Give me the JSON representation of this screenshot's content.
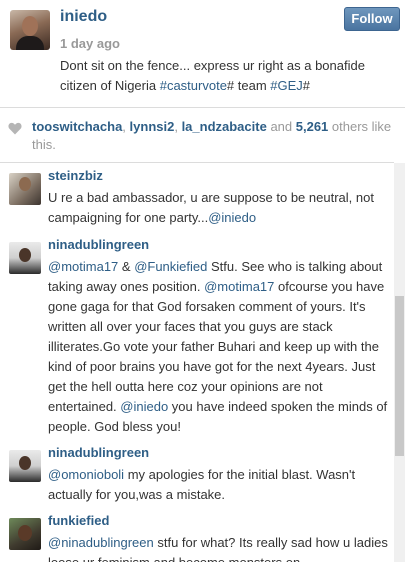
{
  "post": {
    "username": "iniedo",
    "timestamp": "1 day ago",
    "follow_label": "Follow",
    "caption_text": "Dont sit on the fence... express ur right as a bonafide citizen of Nigeria ",
    "caption_tag1": "#casturvote",
    "caption_mid": "# team ",
    "caption_tag2": "#GEJ",
    "caption_end": "#"
  },
  "likes": {
    "user1": "tooswitchacha",
    "sep1": ", ",
    "user2": "lynnsi2",
    "sep2": ", ",
    "user3": "la_ndzabacite",
    "and_text": " and ",
    "count": "5,261",
    "suffix": " others like this."
  },
  "comments": [
    {
      "username": "steinzbiz",
      "text_a": "U re a bad ambassador, u are suppose to be neutral, not campaigning for one party...",
      "mention_a": "@iniedo"
    },
    {
      "username": "ninadublingreen",
      "mention_a": "@motima17",
      "text_a": " & ",
      "mention_b": "@Funkiefied",
      "text_b": " Stfu. See who is talking about taking away ones position. ",
      "mention_c": "@motima17",
      "text_c": " ofcourse you have gone gaga for that God forsaken comment of yours. It's written all over your faces that you guys are stack illiterates.Go vote your father Buhari and keep up with the kind of poor brains you have got for the next 4years. Just get the hell outta here coz your opinions are not entertained. ",
      "mention_d": "@iniedo",
      "text_d": " you have indeed spoken the minds of people. God bless you!"
    },
    {
      "username": "ninadublingreen",
      "mention_a": "@omonioboli",
      "text_a": " my apologies for the initial blast. Wasn't actually for you,was a mistake."
    },
    {
      "username": "funkiefied",
      "mention_a": "@ninadublingreen",
      "text_a": " stfu for what? Its really sad how u ladies loose ur feminism and become monsters on"
    }
  ],
  "icons": {
    "heart": "heart-icon"
  },
  "colors": {
    "link": "#2e5e86",
    "follow_button": "#4a74a0",
    "muted": "#999999"
  }
}
